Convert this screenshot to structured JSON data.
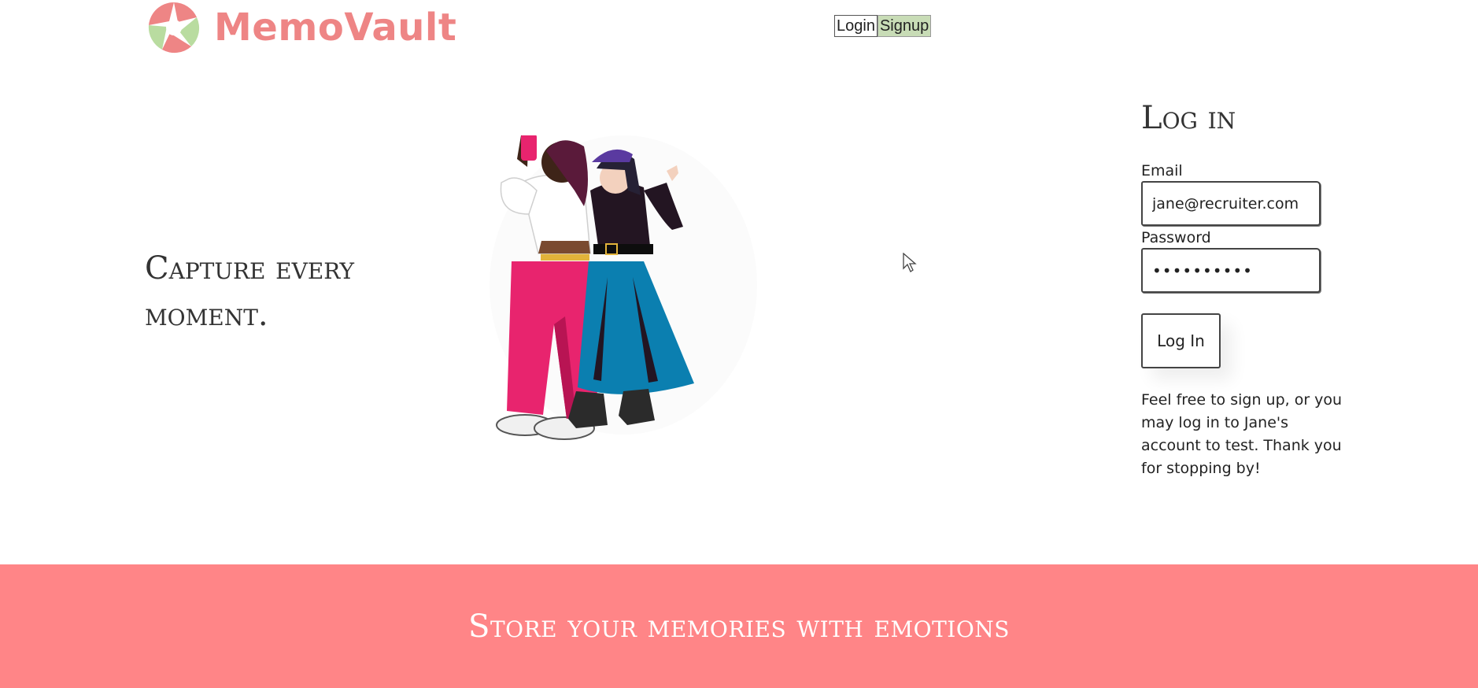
{
  "brand": {
    "name": "MemoVault",
    "logo_icon": "aperture-logo-icon",
    "colors": {
      "text": "#ee8585",
      "petal_green": "#b9dca0",
      "petal_pink": "#ee8585"
    }
  },
  "nav": {
    "login_label": "Login",
    "signup_label": "Signup"
  },
  "hero": {
    "tagline": "Capture every moment.",
    "illustration_icon": "friends-selfie-illustration"
  },
  "login": {
    "title": "Log in",
    "email_label": "Email",
    "email_value": "jane@recruiter.com",
    "password_label": "Password",
    "password_value": "••••••••••",
    "submit_label": "Log In",
    "note": "Feel free to sign up, or you may log in to Jane's account to test. Thank you for stopping by!"
  },
  "banner": {
    "text": "Store your memories with emotions",
    "color": "#ff8587"
  },
  "cursor_icon": "mouse-pointer-icon"
}
